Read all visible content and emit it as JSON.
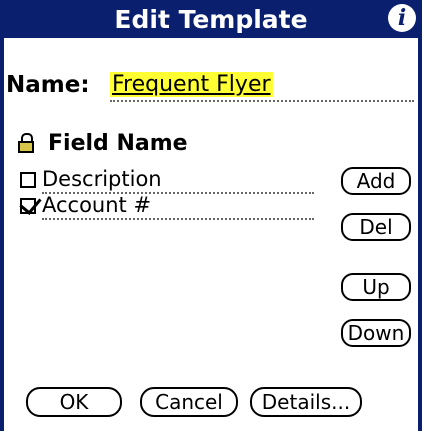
{
  "window": {
    "title": "Edit Template",
    "info_icon": "info-icon"
  },
  "name_field": {
    "label": "Name:",
    "value": "Frequent Flyer"
  },
  "field_list": {
    "header": "Field Name",
    "header_icon": "lock-icon",
    "items": [
      {
        "label": "Description",
        "checked": false
      },
      {
        "label": "Account #",
        "checked": true
      }
    ]
  },
  "side_buttons": {
    "add": "Add",
    "del": "Del",
    "up": "Up",
    "down": "Down"
  },
  "bottom_buttons": {
    "ok": "OK",
    "cancel": "Cancel",
    "details": "Details..."
  },
  "colors": {
    "titlebar": "#0a1f6e",
    "name_highlight": "#ffff33",
    "lock_icon": "#d8c64a"
  }
}
